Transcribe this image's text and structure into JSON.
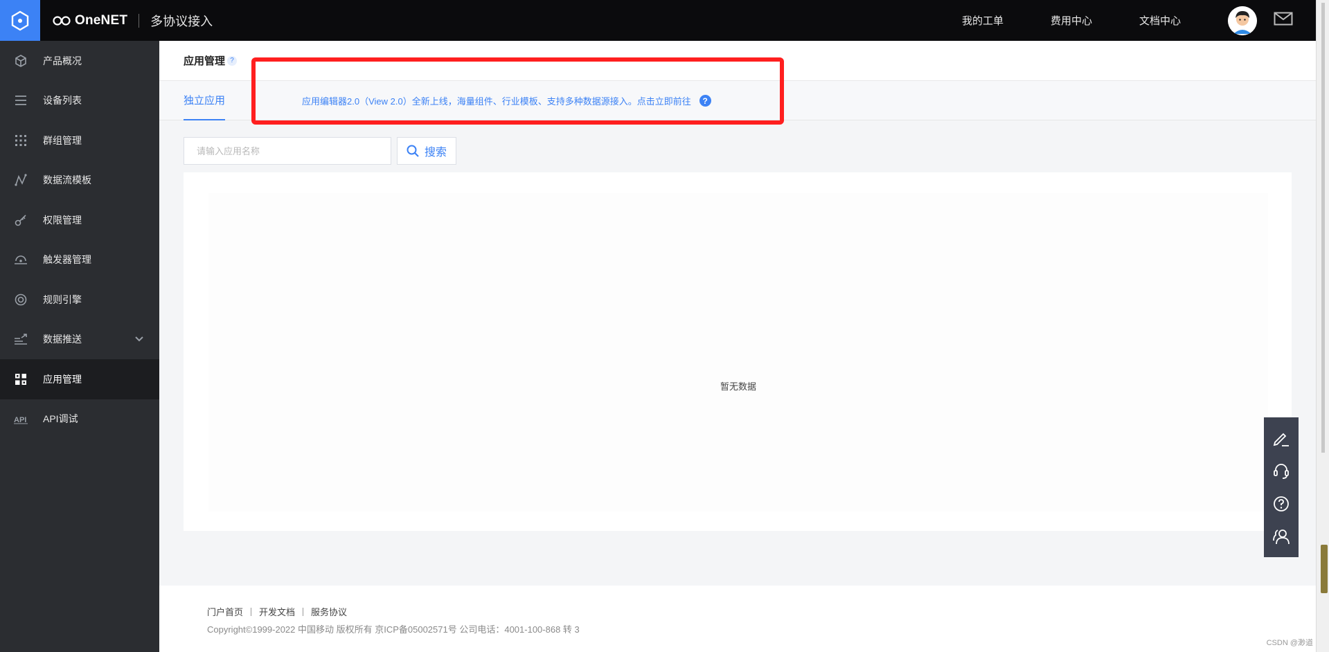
{
  "brand": {
    "name": "OneNET",
    "subtitle": "多协议接入"
  },
  "topnav": {
    "items": [
      "我的工单",
      "费用中心",
      "文档中心"
    ]
  },
  "sidebar": {
    "items": [
      {
        "label": "产品概况",
        "icon": "cube-icon"
      },
      {
        "label": "设备列表",
        "icon": "list-icon"
      },
      {
        "label": "群组管理",
        "icon": "grid-dots-icon"
      },
      {
        "label": "数据流模板",
        "icon": "datastream-icon"
      },
      {
        "label": "权限管理",
        "icon": "key-icon"
      },
      {
        "label": "触发器管理",
        "icon": "trigger-icon"
      },
      {
        "label": "规则引擎",
        "icon": "rule-engine-icon"
      },
      {
        "label": "数据推送",
        "icon": "data-push-icon"
      },
      {
        "label": "应用管理",
        "icon": "apps-icon"
      },
      {
        "label": "API调试",
        "icon": "api-icon"
      }
    ],
    "active": "应用管理"
  },
  "page": {
    "title": "应用管理",
    "help": "?",
    "tab": "独立应用",
    "promo": "应用编辑器2.0（View 2.0）全新上线，海量组件、行业模板、支持多种数据源接入。点击立即前往",
    "promo_help": "?"
  },
  "search": {
    "placeholder": "请输入应用名称",
    "value": "",
    "button_label": "搜索"
  },
  "table": {
    "empty_text": "暂无数据"
  },
  "footer": {
    "links": [
      "门户首页",
      "开发文档",
      "服务协议"
    ],
    "copyright": "Copyright©1999-2022 中国移动 版权所有 京ICP备05002571号 公司电话：4001-100-868 转 3",
    "watermark": "CSDN @渺道"
  },
  "float_tools": [
    "edit-icon",
    "headset-icon",
    "question-icon",
    "users-icon"
  ],
  "colors": {
    "accent": "#3c82f5",
    "sidebar_bg": "#2b2d31",
    "topbar_bg": "#0b0b0d",
    "highlight_box": "#ff1f1f"
  }
}
